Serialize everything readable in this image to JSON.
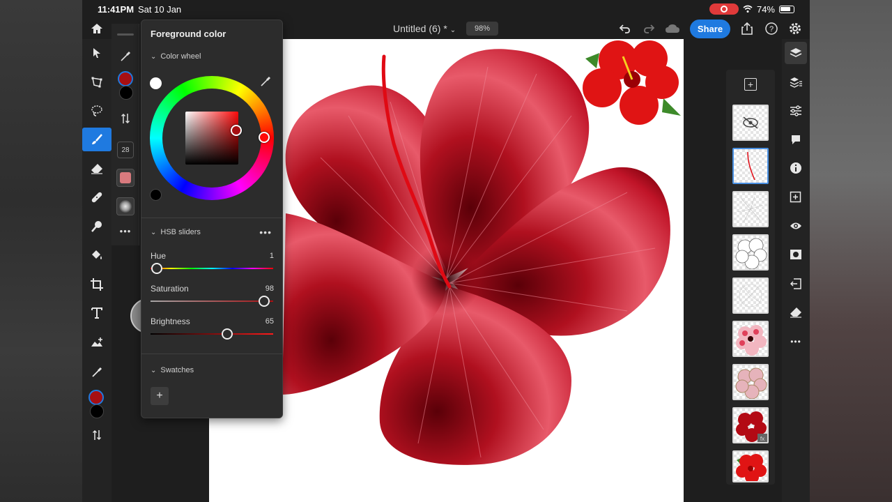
{
  "status": {
    "time": "11:41PM",
    "date": "Sat 10 Jan",
    "battery": "74%",
    "icons": [
      "screen-record-icon",
      "wifi-icon",
      "battery-icon"
    ]
  },
  "header": {
    "document_title": "Untitled (6) *",
    "zoom": "98%",
    "share_label": "Share",
    "icons": [
      "undo-icon",
      "redo-icon",
      "cloud-icon",
      "export-icon",
      "help-icon",
      "settings-icon"
    ]
  },
  "left_toolbar": {
    "tools": [
      "home-icon",
      "select-icon",
      "transform-icon",
      "lasso-icon",
      "brush-icon",
      "eraser-icon",
      "heal-icon",
      "smudge-icon",
      "fill-icon",
      "crop-icon",
      "type-icon",
      "place-image-icon",
      "eyedropper-icon"
    ],
    "active_tool": "brush-icon"
  },
  "brush_panel": {
    "brush_size": "28"
  },
  "color_popover": {
    "title": "Foreground color",
    "wheel_section": "Color wheel",
    "hsb_section": "HSB sliders",
    "swatches_section": "Swatches",
    "add_swatch": "+",
    "hue": {
      "label": "Hue",
      "value": "1"
    },
    "saturation": {
      "label": "Saturation",
      "value": "98"
    },
    "brightness": {
      "label": "Brightness",
      "value": "65"
    },
    "foreground_hex": "#a60f12"
  },
  "layers": {
    "count": 9,
    "selected_index": 1
  },
  "right_toolbar": {
    "tools": [
      "layers-icon",
      "layer-stack-icon",
      "adjustments-icon",
      "comment-icon",
      "info-icon",
      "add-layer-icon",
      "visibility-icon",
      "mask-icon",
      "import-icon",
      "clear-icon",
      "more-icon"
    ]
  },
  "colors": {
    "accent": "#1f7ae0",
    "petal_red": "#c8102e"
  }
}
